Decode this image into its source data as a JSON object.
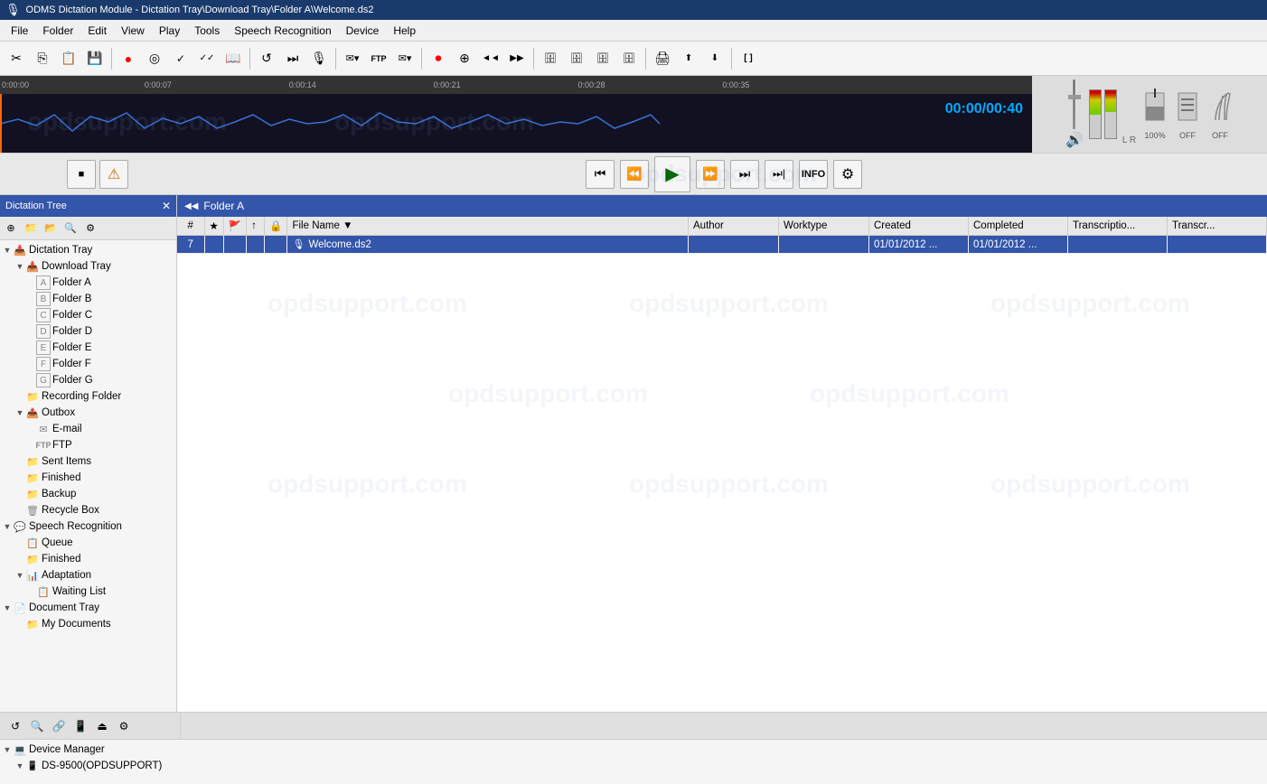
{
  "window": {
    "title": "ODMS Dictation Module - Dictation Tray\\Download Tray\\Folder A\\Welcome.ds2"
  },
  "menu": {
    "items": [
      "File",
      "Folder",
      "Edit",
      "View",
      "Play",
      "Tools",
      "Speech Recognition",
      "Device",
      "Help"
    ]
  },
  "toolbar": {
    "buttons": [
      {
        "name": "cut",
        "icon": "✂",
        "label": "Cut"
      },
      {
        "name": "copy",
        "icon": "⎘",
        "label": "Copy"
      },
      {
        "name": "paste",
        "icon": "📋",
        "label": "Paste"
      },
      {
        "name": "save",
        "icon": "💾",
        "label": "Save"
      },
      {
        "name": "record",
        "icon": "●",
        "label": "Record"
      },
      {
        "name": "listen",
        "icon": "◉",
        "label": "Listen"
      },
      {
        "name": "refresh",
        "icon": "↺",
        "label": "Refresh"
      },
      {
        "name": "end-skip",
        "icon": "⏭",
        "label": "End Skip"
      },
      {
        "name": "mic",
        "icon": "🎤",
        "label": "Microphone"
      },
      {
        "name": "envelope1",
        "icon": "✉",
        "label": "Send"
      },
      {
        "name": "ftp",
        "icon": "FTP",
        "label": "FTP"
      },
      {
        "name": "envelope2",
        "icon": "✉",
        "label": "Email"
      },
      {
        "name": "record2",
        "icon": "⏺",
        "label": "Record2"
      },
      {
        "name": "insert",
        "icon": "⊕",
        "label": "Insert"
      },
      {
        "name": "back",
        "icon": "◄◄",
        "label": "Back"
      },
      {
        "name": "forward",
        "icon": "▶▶",
        "label": "Forward"
      },
      {
        "name": "rewind",
        "icon": "◀◀",
        "label": "Rewind"
      },
      {
        "name": "fast-fwd",
        "icon": "▶▶",
        "label": "Fast Forward"
      },
      {
        "name": "db1",
        "icon": "🗄",
        "label": "DB1"
      },
      {
        "name": "db2",
        "icon": "🗄",
        "label": "DB2"
      },
      {
        "name": "db3",
        "icon": "🗄",
        "label": "DB3"
      },
      {
        "name": "print",
        "icon": "🖨",
        "label": "Print"
      },
      {
        "name": "check",
        "icon": "✓",
        "label": "Check"
      },
      {
        "name": "check2",
        "icon": "✓✓",
        "label": "Check All"
      },
      {
        "name": "export",
        "icon": "⬆",
        "label": "Export"
      },
      {
        "name": "import",
        "icon": "⬇",
        "label": "Import"
      },
      {
        "name": "bracket",
        "icon": "[]",
        "label": "Bracket"
      }
    ]
  },
  "waveform": {
    "current_time": "00:00",
    "total_time": "00:40",
    "ruler_marks": [
      "0:00:00",
      "0:00:07",
      "0:00:14",
      "0:00:21",
      "0:00:28",
      "0:00:35"
    ]
  },
  "playback": {
    "buttons": [
      {
        "name": "stop",
        "icon": "■"
      },
      {
        "name": "prev",
        "icon": "⏮"
      },
      {
        "name": "rewind",
        "icon": "⏪"
      },
      {
        "name": "play",
        "icon": "▶"
      },
      {
        "name": "fast-forward",
        "icon": "⏩"
      },
      {
        "name": "next-section",
        "icon": "⏭"
      },
      {
        "name": "end",
        "icon": "⏭|"
      }
    ],
    "info_label": "INFO",
    "settings_label": "⚙"
  },
  "right_controls": {
    "percent": "100%",
    "off1": "OFF",
    "off2": "OFF"
  },
  "left_panel": {
    "title": "Dictation Tree",
    "tree": [
      {
        "id": "dictation-tray",
        "label": "Dictation Tray",
        "level": 0,
        "expanded": true,
        "icon": "tray"
      },
      {
        "id": "download-tray",
        "label": "Download Tray",
        "level": 1,
        "expanded": true,
        "icon": "tray"
      },
      {
        "id": "folder-a",
        "label": "Folder A",
        "level": 2,
        "icon": "folder-a"
      },
      {
        "id": "folder-b",
        "label": "Folder B",
        "level": 2,
        "icon": "folder-b"
      },
      {
        "id": "folder-c",
        "label": "Folder C",
        "level": 2,
        "icon": "folder-c"
      },
      {
        "id": "folder-d",
        "label": "Folder D",
        "level": 2,
        "icon": "folder-d"
      },
      {
        "id": "folder-e",
        "label": "Folder E",
        "level": 2,
        "icon": "folder-e"
      },
      {
        "id": "folder-f",
        "label": "Folder F",
        "level": 2,
        "icon": "folder-f"
      },
      {
        "id": "folder-g",
        "label": "Folder G",
        "level": 2,
        "icon": "folder-g"
      },
      {
        "id": "recording-folder",
        "label": "Recording Folder",
        "level": 1,
        "icon": "recording"
      },
      {
        "id": "outbox",
        "label": "Outbox",
        "level": 1,
        "expanded": true,
        "icon": "outbox"
      },
      {
        "id": "email",
        "label": "E-mail",
        "level": 2,
        "icon": "email"
      },
      {
        "id": "ftp",
        "label": "FTP",
        "level": 2,
        "icon": "ftp"
      },
      {
        "id": "sent-items",
        "label": "Sent Items",
        "level": 1,
        "icon": "sent"
      },
      {
        "id": "finished",
        "label": "Finished",
        "level": 1,
        "icon": "finished"
      },
      {
        "id": "backup",
        "label": "Backup",
        "level": 1,
        "icon": "backup"
      },
      {
        "id": "recycle-box",
        "label": "Recycle Box",
        "level": 1,
        "icon": "recycle"
      },
      {
        "id": "speech-recognition",
        "label": "Speech Recognition",
        "level": 0,
        "expanded": true,
        "icon": "speech"
      },
      {
        "id": "queue",
        "label": "Queue",
        "level": 1,
        "icon": "queue"
      },
      {
        "id": "sr-finished",
        "label": "Finished",
        "level": 1,
        "icon": "finished"
      },
      {
        "id": "adaptation",
        "label": "Adaptation",
        "level": 1,
        "expanded": true,
        "icon": "adaptation"
      },
      {
        "id": "waiting-list",
        "label": "Waiting List",
        "level": 2,
        "icon": "waiting"
      },
      {
        "id": "document-tray",
        "label": "Document Tray",
        "level": 0,
        "expanded": true,
        "icon": "doc-tray"
      },
      {
        "id": "my-documents",
        "label": "My Documents",
        "level": 1,
        "icon": "my-docs"
      }
    ]
  },
  "folder_header": {
    "icon": "◀◀",
    "title": "Folder A"
  },
  "file_table": {
    "columns": [
      {
        "id": "num",
        "label": "#"
      },
      {
        "id": "star",
        "label": "★"
      },
      {
        "id": "flag",
        "label": "🚩"
      },
      {
        "id": "prio",
        "label": "↑"
      },
      {
        "id": "lock",
        "label": "🔒"
      },
      {
        "id": "filename",
        "label": "File Name"
      },
      {
        "id": "author",
        "label": "Author"
      },
      {
        "id": "worktype",
        "label": "Worktype"
      },
      {
        "id": "created",
        "label": "Created"
      },
      {
        "id": "completed",
        "label": "Completed"
      },
      {
        "id": "transcription",
        "label": "Transcriptio..."
      },
      {
        "id": "transcription2",
        "label": "Transcr..."
      }
    ],
    "rows": [
      {
        "num": "7",
        "star": "",
        "flag": "",
        "prio": "",
        "lock": "",
        "filename": "Welcome.ds2",
        "author": "",
        "worktype": "",
        "created": "01/01/2012 ...",
        "completed": "01/01/2012 ...",
        "transcription": "",
        "transcription2": "",
        "selected": true
      }
    ]
  },
  "bottom_toolbar": {
    "buttons": [
      {
        "name": "refresh-btn",
        "icon": "↺"
      },
      {
        "name": "search-btn",
        "icon": "🔍"
      },
      {
        "name": "connect-btn",
        "icon": "🔗"
      },
      {
        "name": "device-btn",
        "icon": "📱"
      },
      {
        "name": "eject-btn",
        "icon": "⏏"
      },
      {
        "name": "settings-btn",
        "icon": "⚙"
      }
    ]
  },
  "device_section": {
    "title": "Device Manager",
    "devices": [
      {
        "label": "DS-9500(OPDSUPPORT)",
        "expanded": false
      }
    ]
  },
  "watermarks": [
    "opdsupport.com",
    "opdsupport.com",
    "opdsupport.com"
  ]
}
